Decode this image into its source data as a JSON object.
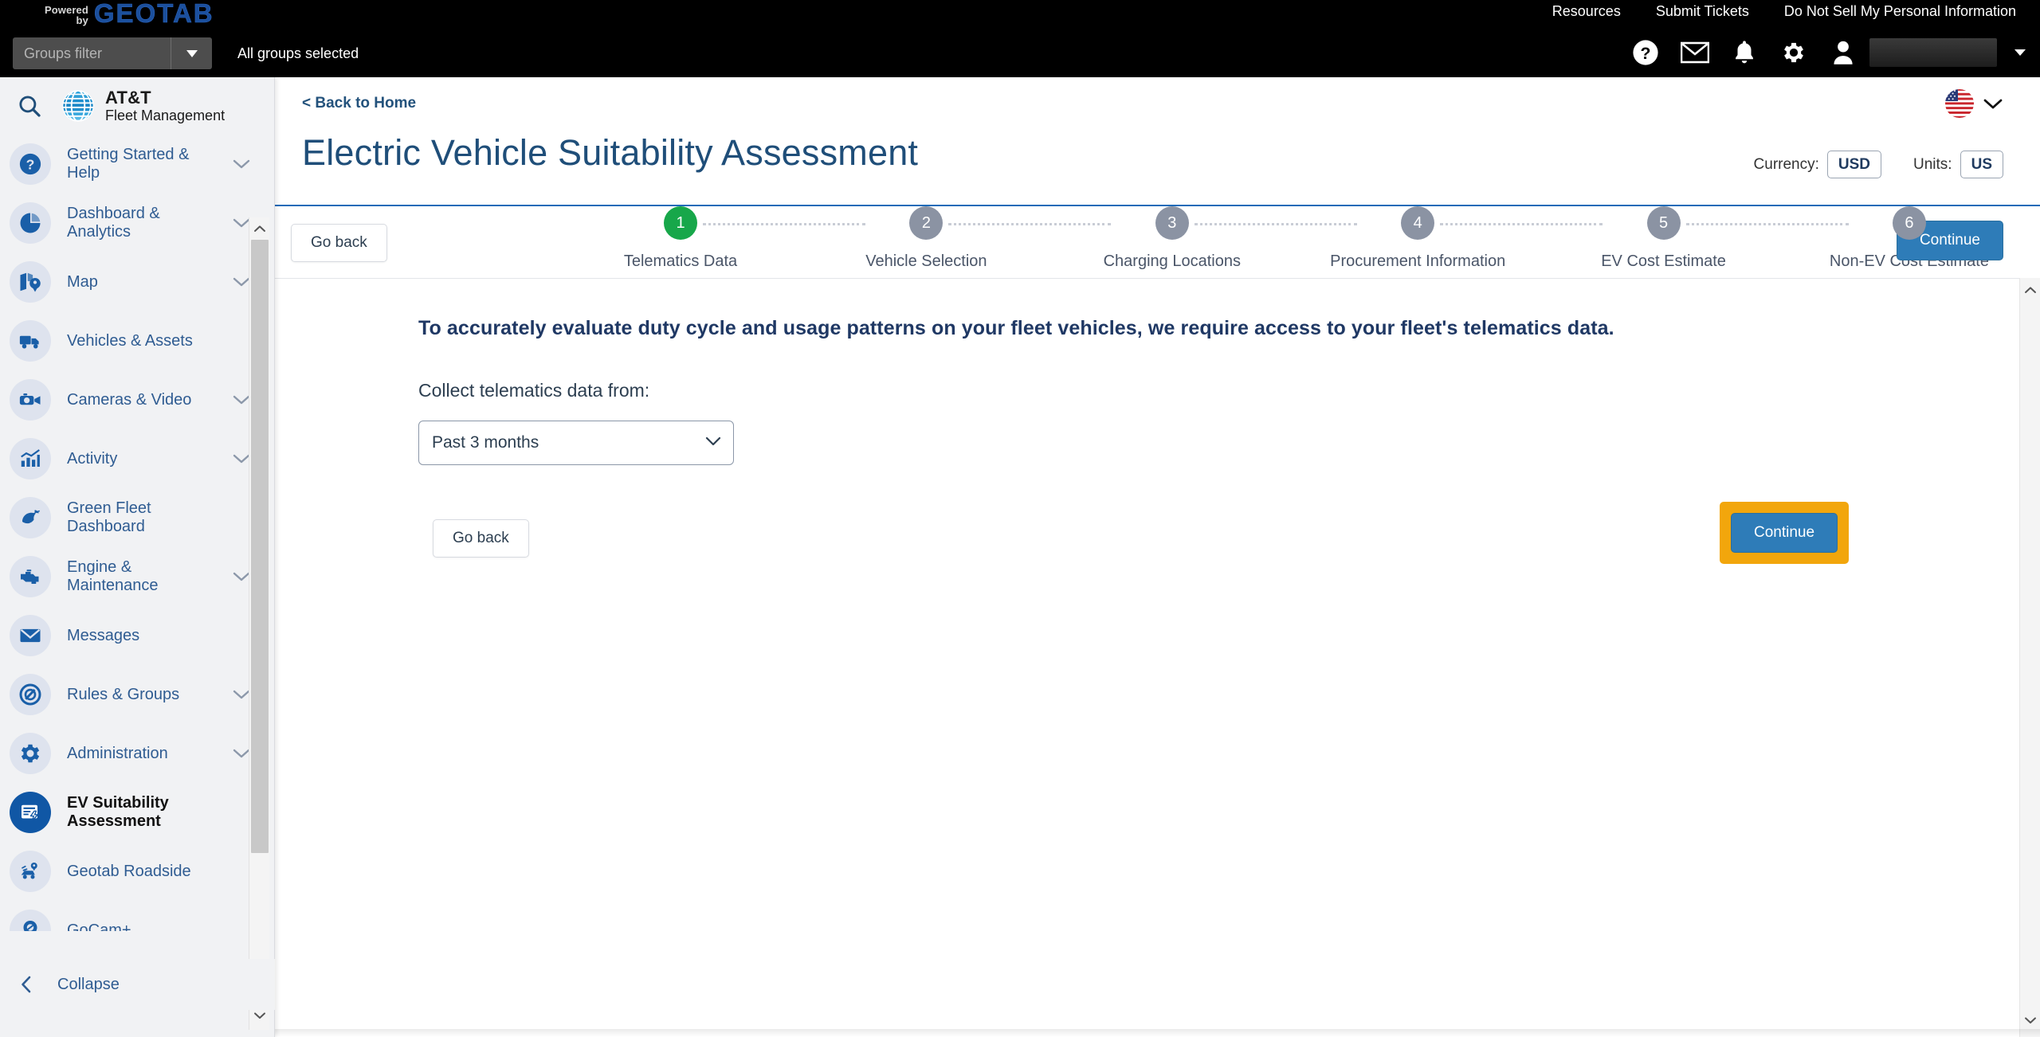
{
  "topbar": {
    "powered": "Powered",
    "by": "by",
    "brand": "GEOTAB",
    "links": [
      {
        "label": "Resources"
      },
      {
        "label": "Submit Tickets"
      },
      {
        "label": "Do Not Sell My Personal Information"
      }
    ],
    "groups_filter_placeholder": "Groups filter",
    "groups_status": "All groups selected",
    "icons": [
      {
        "name": "help-icon"
      },
      {
        "name": "mail-icon"
      },
      {
        "name": "bell-icon"
      },
      {
        "name": "gear-icon"
      },
      {
        "name": "user-icon"
      }
    ],
    "username": ""
  },
  "sidebar": {
    "search_icon": "search-icon",
    "brand_line1": "AT&T",
    "brand_line2": "Fleet Management",
    "items": [
      {
        "label": "Getting Started & Help",
        "icon": "help-circle-icon",
        "chevron": true,
        "active": false
      },
      {
        "label": "Dashboard & Analytics",
        "icon": "pie-chart-icon",
        "chevron": true,
        "active": false
      },
      {
        "label": "Map",
        "icon": "map-pin-icon",
        "chevron": true,
        "active": false
      },
      {
        "label": "Vehicles & Assets",
        "icon": "truck-icon",
        "chevron": false,
        "active": false
      },
      {
        "label": "Cameras & Video",
        "icon": "camera-icon",
        "chevron": true,
        "active": false
      },
      {
        "label": "Activity",
        "icon": "bar-chart-icon",
        "chevron": true,
        "active": false
      },
      {
        "label": "Green Fleet Dashboard",
        "icon": "leaf-icon",
        "chevron": false,
        "active": false
      },
      {
        "label": "Engine & Maintenance",
        "icon": "engine-icon",
        "chevron": true,
        "active": false
      },
      {
        "label": "Messages",
        "icon": "envelope-icon",
        "chevron": false,
        "active": false
      },
      {
        "label": "Rules & Groups",
        "icon": "no-entry-icon",
        "chevron": true,
        "active": false
      },
      {
        "label": "Administration",
        "icon": "gear-icon",
        "chevron": true,
        "active": false
      },
      {
        "label": "EV Suitability Assessment",
        "icon": "ev-assessment-icon",
        "chevron": false,
        "active": true
      },
      {
        "label": "Geotab Roadside",
        "icon": "roadside-car-icon",
        "chevron": false,
        "active": false
      },
      {
        "label": "GoCam+",
        "icon": "gocam-pin-icon",
        "chevron": false,
        "active": false
      }
    ],
    "collapse_label": "Collapse"
  },
  "page": {
    "back_link": "< Back to Home",
    "title": "Electric Vehicle Suitability Assessment",
    "currency_label": "Currency:",
    "currency_value": "USD",
    "units_label": "Units:",
    "units_value": "US",
    "flag_icon": "us-flag-icon",
    "locale_chevron": "chevron-down-icon"
  },
  "toolbar": {
    "go_back_label": "Go back",
    "continue_label": "Continue"
  },
  "stepper": {
    "steps": [
      {
        "number": "1",
        "label": "Telematics Data",
        "state": "active"
      },
      {
        "number": "2",
        "label": "Vehicle Selection",
        "state": "pending"
      },
      {
        "number": "3",
        "label": "Charging Locations",
        "state": "pending"
      },
      {
        "number": "4",
        "label": "Procurement Information",
        "state": "pending"
      },
      {
        "number": "5",
        "label": "EV Cost Estimate",
        "state": "pending"
      },
      {
        "number": "6",
        "label": "Non-EV Cost Estimate",
        "state": "pending"
      }
    ],
    "active_color": "#17a74a",
    "pending_color": "#8b93a3"
  },
  "content": {
    "lead": "To accurately evaluate duty cycle and usage patterns on your fleet vehicles, we require access to your fleet's telematics data.",
    "field_label": "Collect telematics data from:",
    "select_value": "Past 3 months",
    "select_options": [
      "Past 3 months"
    ],
    "go_back_label": "Go back",
    "continue_label": "Continue",
    "highlight_color": "#f2a60c",
    "continue_color": "#2e7cb8"
  }
}
